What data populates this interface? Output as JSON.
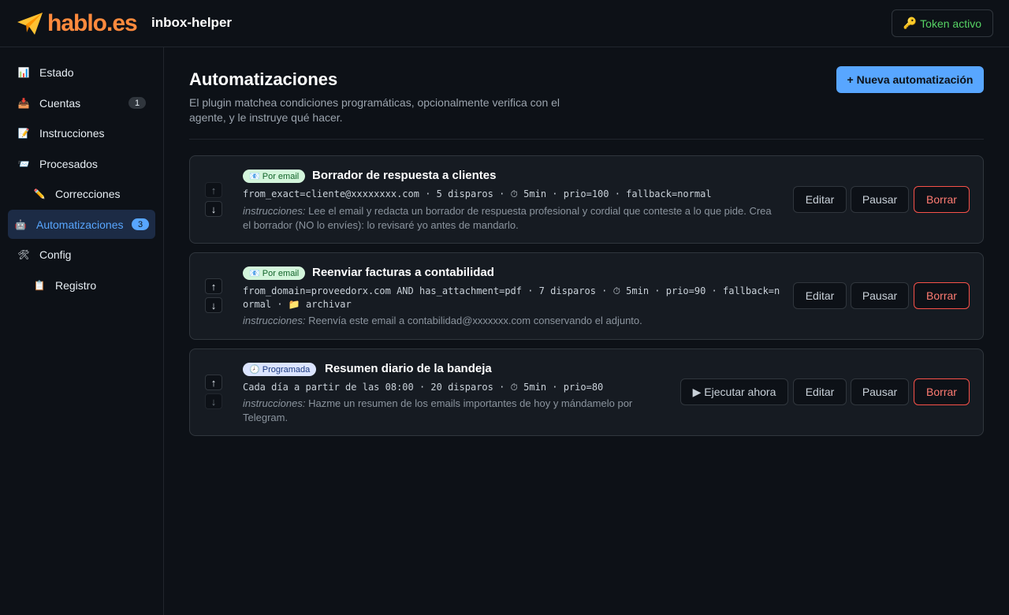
{
  "header": {
    "logo_text": "hablo.es",
    "app_name": "inbox-helper",
    "token_label": "Token activo",
    "token_icon": "key-icon"
  },
  "sidebar": {
    "items": [
      {
        "icon": "📊",
        "icon_name": "chart-icon",
        "label": "Estado"
      },
      {
        "icon": "📥",
        "icon_name": "inbox-icon",
        "label": "Cuentas",
        "badge": "1"
      },
      {
        "icon": "📝",
        "icon_name": "memo-icon",
        "label": "Instrucciones"
      },
      {
        "icon": "📨",
        "icon_name": "envelope-icon",
        "label": "Procesados"
      },
      {
        "icon": "✏️",
        "icon_name": "pencil-icon",
        "label": "Correcciones"
      },
      {
        "icon": "🤖",
        "icon_name": "robot-icon",
        "label": "Automatizaciones",
        "badge": "3"
      },
      {
        "icon": "🛠",
        "icon_name": "tools-icon",
        "label": "Config"
      },
      {
        "icon": "📋",
        "icon_name": "clipboard-icon",
        "label": "Registro"
      }
    ]
  },
  "main": {
    "title": "Automatizaciones",
    "description": "El plugin matchea condiciones programáticas, opcionalmente verifica con el agente, y le instruye qué hacer.",
    "new_button": "+ Nueva automatización",
    "instr_prefix": "instrucciones:",
    "buttons": {
      "run_now": "▶ Ejecutar ahora",
      "edit": "Editar",
      "pause": "Pausar",
      "delete": "Borrar"
    },
    "automations": [
      {
        "tag": "📧 Por email",
        "title": "Borrador de respuesta a clientes",
        "meta": "from_exact=cliente@xxxxxxxx.com · 5 disparos · ⏱ 5min · prio=100 · fallback=normal",
        "instructions": "Lee el email y redacta un borrador de respuesta profesional y cordial que conteste a lo que pide. Crea el borrador (NO lo envíes): lo revisaré yo antes de mandarlo."
      },
      {
        "tag": "📧 Por email",
        "title": "Reenviar facturas a contabilidad",
        "meta": "from_domain=proveedorx.com AND has_attachment=pdf · 7 disparos · ⏱ 5min · prio=90 · fallback=normal · 📁 archivar",
        "instructions": "Reenvía este email a contabilidad@xxxxxxx.com conservando el adjunto."
      },
      {
        "tag": "🕗 Programada",
        "title": "Resumen diario de la bandeja",
        "meta": "Cada día a partir de las 08:00 · 20 disparos · ⏱ 5min · prio=80",
        "instructions": "Hazme un resumen de los emails importantes de hoy y mándamelo por Telegram."
      }
    ]
  },
  "colors": {
    "background": "#0d1117",
    "accent": "#58a6ff",
    "logo": "#ff8a3d",
    "token": "#56d364",
    "danger": "#ff7b72"
  }
}
